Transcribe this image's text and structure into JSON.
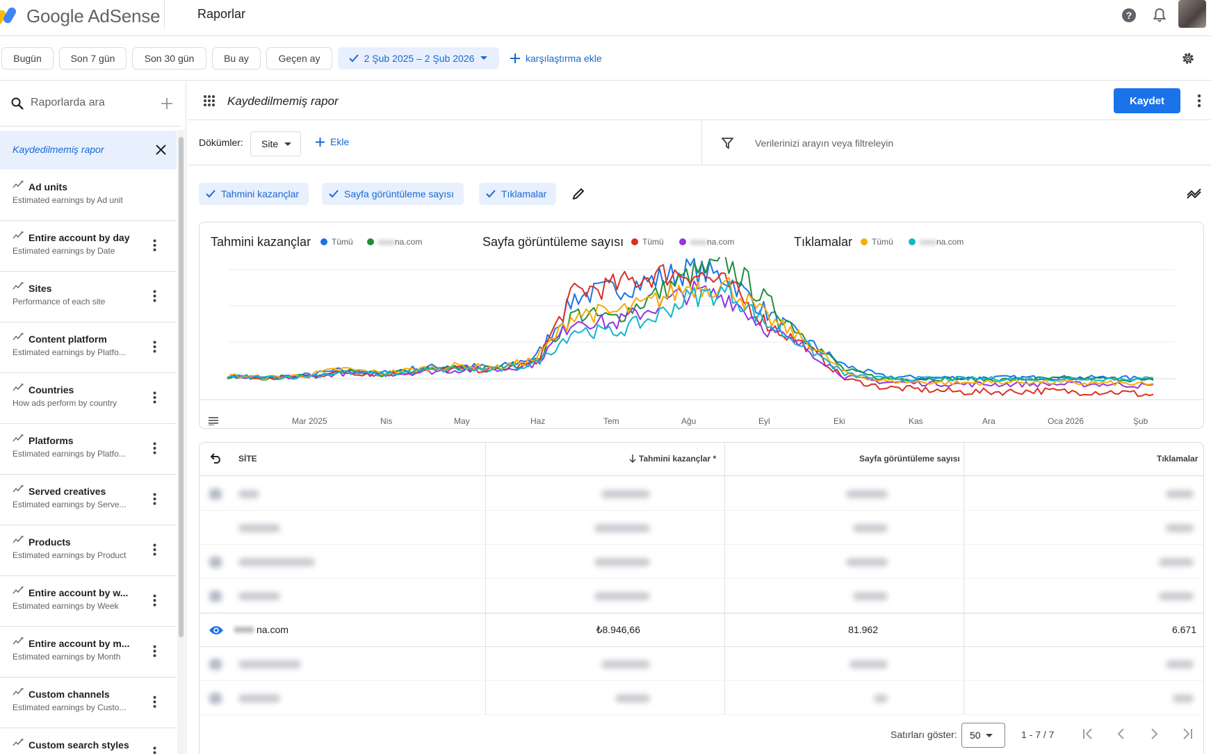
{
  "app": {
    "name": "Google AdSense",
    "page_title": "Raporlar"
  },
  "date_bar": {
    "presets": [
      "Bugün",
      "Son 7 gün",
      "Son 30 gün",
      "Bu ay",
      "Geçen ay"
    ],
    "range_label": "2 Şub 2025 – 2 Şub 2026",
    "compare_label": "karşılaştırma ekle"
  },
  "sidebar": {
    "search_placeholder": "Raporlarda ara",
    "unsaved_label": "Kaydedilmemiş rapor",
    "items": [
      {
        "title": "Ad units",
        "subtitle": "Estimated earnings by Ad unit"
      },
      {
        "title": "Entire account by day",
        "subtitle": "Estimated earnings by Date"
      },
      {
        "title": "Sites",
        "subtitle": "Performance of each site"
      },
      {
        "title": "Content platform",
        "subtitle": "Estimated earnings by Platfo..."
      },
      {
        "title": "Countries",
        "subtitle": "How ads perform by country"
      },
      {
        "title": "Platforms",
        "subtitle": "Estimated earnings by Platfo..."
      },
      {
        "title": "Served creatives",
        "subtitle": "Estimated earnings by Serve..."
      },
      {
        "title": "Products",
        "subtitle": "Estimated earnings by Product"
      },
      {
        "title": "Entire account by w...",
        "subtitle": "Estimated earnings by Week"
      },
      {
        "title": "Entire account by m...",
        "subtitle": "Estimated earnings by Month"
      },
      {
        "title": "Custom channels",
        "subtitle": "Estimated earnings by Custo..."
      },
      {
        "title": "Custom search styles",
        "subtitle": ""
      }
    ]
  },
  "report": {
    "title": "Kaydedilmemiş rapor",
    "save_label": "Kaydet",
    "breakdown_label": "Dökümler:",
    "breakdown_value": "Site",
    "add_label": "Ekle",
    "filter_placeholder": "Verilerinizi arayın veya filtreleyin",
    "metrics": [
      "Tahmini kazançlar",
      "Sayfa görüntüleme sayısı",
      "Tıklamalar"
    ]
  },
  "legend": {
    "groups": [
      {
        "title": "Tahmini kazançlar",
        "all": "Tümü",
        "site": "na.com"
      },
      {
        "title": "Sayfa görüntüleme sayısı",
        "all": "Tümü",
        "site": "na.com"
      },
      {
        "title": "Tıklamalar",
        "all": "Tümü",
        "site": "na.com"
      }
    ]
  },
  "colors": {
    "earnings_all": "#1a73e8",
    "earnings_site": "#1e8e3e",
    "pageviews_all": "#d93025",
    "pageviews_site": "#9334e6",
    "clicks_all": "#f9ab00",
    "clicks_site": "#12b5cb",
    "accent": "#1967d2"
  },
  "chart_data": {
    "type": "line",
    "x_ticks": [
      "Mar 2025",
      "Nis",
      "May",
      "Haz",
      "Tem",
      "Ağu",
      "Eyl",
      "Eki",
      "Kas",
      "Ara",
      "Oca 2026",
      "Şub"
    ],
    "series": [
      {
        "name": "Tahmini kazançlar · Tümü",
        "color": "#1a73e8",
        "values": [
          0.02,
          0.01,
          0.03,
          0.08,
          0.05,
          0.1,
          0.12,
          0.1,
          0.2,
          0.75,
          0.82,
          0.9,
          1.0,
          0.92,
          0.6,
          0.35,
          0.12,
          0.02,
          0.01,
          0.01,
          0.01,
          0.01,
          0.01,
          0.01,
          0.0
        ]
      },
      {
        "name": "Tahmini kazançlar · na.com",
        "color": "#1e8e3e",
        "values": [
          0.02,
          0.01,
          0.02,
          0.06,
          0.04,
          0.08,
          0.1,
          0.09,
          0.16,
          0.6,
          0.55,
          0.75,
          0.95,
          1.05,
          0.7,
          0.38,
          0.08,
          0.0,
          0.0,
          0.0,
          -0.01,
          0.0,
          0.0,
          0.0,
          -0.02
        ]
      },
      {
        "name": "Sayfa görüntüleme sayısı · Tümü",
        "color": "#d93025",
        "values": [
          0.02,
          0.0,
          0.02,
          0.06,
          0.04,
          0.07,
          0.09,
          0.08,
          0.15,
          0.8,
          0.85,
          0.95,
          0.98,
          0.85,
          0.5,
          0.3,
          0.0,
          -0.08,
          -0.1,
          -0.12,
          -0.12,
          -0.11,
          -0.12,
          -0.12,
          -0.15
        ]
      },
      {
        "name": "Sayfa görüntüleme sayısı · na.com",
        "color": "#9334e6",
        "values": [
          0.02,
          0.0,
          0.02,
          0.05,
          0.04,
          0.06,
          0.08,
          0.08,
          0.14,
          0.55,
          0.5,
          0.65,
          0.8,
          0.75,
          0.45,
          0.28,
          0.02,
          -0.03,
          -0.04,
          -0.05,
          -0.05,
          -0.05,
          -0.05,
          -0.05,
          -0.07
        ]
      },
      {
        "name": "Tıklamalar · Tümü",
        "color": "#f9ab00",
        "values": [
          0.03,
          0.01,
          0.03,
          0.09,
          0.05,
          0.09,
          0.12,
          0.1,
          0.18,
          0.6,
          0.6,
          0.7,
          0.85,
          0.85,
          0.55,
          0.35,
          0.05,
          -0.02,
          -0.03,
          -0.04,
          -0.03,
          -0.03,
          -0.04,
          -0.04,
          -0.06
        ]
      },
      {
        "name": "Tıklamalar · na.com",
        "color": "#12b5cb",
        "values": [
          0.02,
          0.01,
          0.02,
          0.06,
          0.04,
          0.07,
          0.09,
          0.08,
          0.14,
          0.45,
          0.42,
          0.55,
          0.75,
          0.8,
          0.5,
          0.3,
          0.04,
          0.0,
          0.0,
          0.0,
          0.0,
          0.0,
          0.0,
          0.0,
          0.0
        ]
      }
    ]
  },
  "table": {
    "headers": {
      "site": "SİTE",
      "earnings": "Tahmini kazançlar *",
      "pageviews": "Sayfa görüntüleme sayısı",
      "clicks": "Tıklamalar"
    },
    "highlighted_row": {
      "site": "na.com",
      "earnings": "₺8.946,66",
      "pageviews": "81.962",
      "clicks": "6.671"
    }
  },
  "pagination": {
    "label": "Satırları göster:",
    "page_size": "50",
    "range": "1 - 7 / 7"
  }
}
